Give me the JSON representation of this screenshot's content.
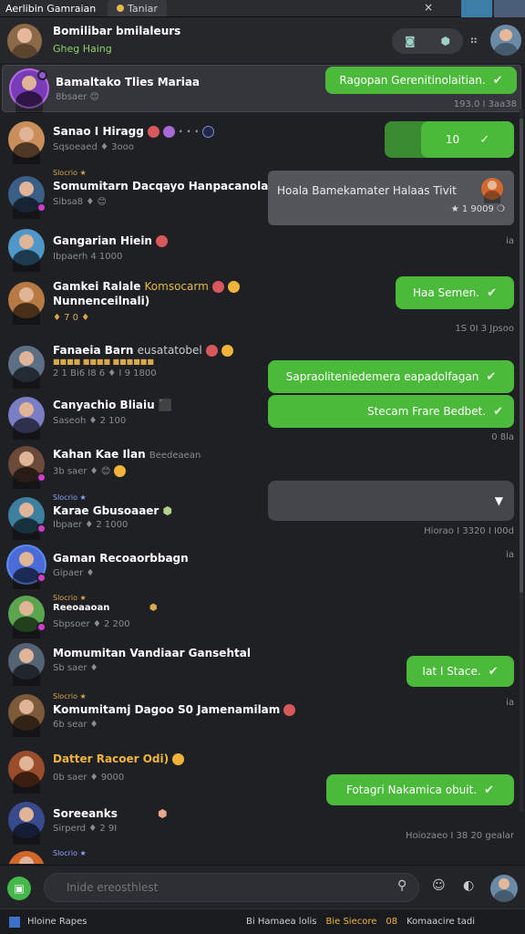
{
  "window": {
    "title": "Aerlibin Gamraian",
    "tab_label": "Taniar",
    "close_glyph": "×"
  },
  "header": {
    "title": "Bomilibar bmilaleurs",
    "subtitle": "Gheg Haing",
    "pill_icons": [
      "camera-icon",
      "box-icon"
    ],
    "grid_glyph": "⠶"
  },
  "conversations": [
    {
      "name": "Bamaltako Tlies Mariaa",
      "meta": "8bsaer 😊",
      "avatar": "#7a3bb8",
      "selected": true,
      "bubble": {
        "text": "Ragopan Gerenitinolaitian.",
        "style": "green",
        "check": true
      },
      "time": "193.0 I 3aa38"
    },
    {
      "name": "Sanao I Hiragg",
      "meta": "Sqsoeaed ♦ 3ooo",
      "avatar": "#c98e5a",
      "bubble": {
        "text": "10",
        "style": "green",
        "check": true
      },
      "time": ""
    },
    {
      "tag": "Slocrio ★",
      "name": "Somumitarn Dacqayo Hanpacanolan",
      "meta": "Sibsa8 ♦ 😊",
      "avatar": "#3a5e86",
      "badge": true,
      "bubble": {
        "text": "Hoala Bamekamater Halaas Tivit",
        "style": "gray",
        "check": false
      },
      "time": "★ 1 9009 ❍"
    },
    {
      "name": "Gangarian Hiein",
      "meta": "Ibpaerh 4 1000",
      "avatar": "#4f97c8",
      "time": "ia"
    },
    {
      "name": "Gamkei Ralale",
      "name_accent": "Komsocarm",
      "name2": "Nunnenceilnali)",
      "meta": "♦ 7 0 ♦",
      "avatar": "#b77a44",
      "bubble": {
        "text": "Haa Semen.",
        "style": "green",
        "check": true
      },
      "time": "1S 0I 3 Jpsoo"
    },
    {
      "tag": "Fanaeia Barn",
      "name": "Fanaeia Barn",
      "name_accent": "eusatatobel",
      "meta": "2 1 Bi6 I8 6 ♦ I 9 1800",
      "avatar": "#5c6f85",
      "bubble": {
        "text": "Sapraoliteniedemera eapadolfagan",
        "style": "green",
        "check": true
      },
      "time": ""
    },
    {
      "name": "Canyachio Bliaiu",
      "meta": "Saseoh ♦ 2 100",
      "avatar": "#7a7ec4",
      "bubble": {
        "text": "Stecam Frare Bedbet.",
        "style": "green",
        "check": true
      },
      "time": "0 8la"
    },
    {
      "name": "Kahan Kae Ilan",
      "name_accent": "Beedeaean",
      "meta": "3b saer ♦ 😊",
      "avatar": "#6b4a3a",
      "badge": true,
      "time": ""
    },
    {
      "tag": "Slocrio ★",
      "name": "Karae Gbusoaaer",
      "meta": "Ibpaer ♦ 2 1000",
      "avatar": "#3c7f9e",
      "badge": true,
      "bubble": {
        "text": "",
        "style": "empty",
        "arrow": true
      },
      "time": "Hiorao I 3320 I I00d"
    },
    {
      "name": "Gaman Recoaorbbagn",
      "meta": "Gipaer ♦",
      "avatar": "#4a6bd8",
      "badge": true,
      "time": "ia"
    },
    {
      "tag": "Slocrio ★",
      "name": "Reeoaaoan",
      "meta": "Sbpsoer ♦ 2 200",
      "avatar": "#5aa54e",
      "badge": true,
      "time": ""
    },
    {
      "name": "Momumitan Vandiaar Gansehtal",
      "meta": "Sb saer ♦",
      "avatar": "#556377",
      "bubble": {
        "text": "Iat I Stace.",
        "style": "green",
        "check": true
      },
      "time": ""
    },
    {
      "tag": "Slocrio ★",
      "name": "Komumitamj Dagoo S0 Jamenamilam",
      "meta": "6b sear ♦",
      "avatar": "#7d5a3a",
      "time": "ia"
    },
    {
      "name": "Datter Racoer Odi)",
      "meta": "0b saer ♦ 9000",
      "avatar": "#9a4d2c",
      "bubble": {
        "text": "Fotagri Nakamica obuit.",
        "style": "green",
        "check": true
      },
      "time": "Hoiozaeo I 38 20 gealar"
    },
    {
      "name": "Soreeanks",
      "meta": "Sirperd ♦ 2 9I",
      "avatar": "#364a8c",
      "time": ""
    },
    {
      "tag": "Slocrio ★",
      "name": "",
      "meta": "",
      "avatar": "#d0662a",
      "time": ""
    }
  ],
  "composer": {
    "placeholder": "Inide ereosthlest",
    "attach_icon": "attach-icon"
  },
  "statusbar": {
    "left": "Hloine Rapes",
    "items": [
      "Bi Hamaea lolis",
      "Bie Siecore",
      "08",
      "Komaacire tadi"
    ]
  }
}
